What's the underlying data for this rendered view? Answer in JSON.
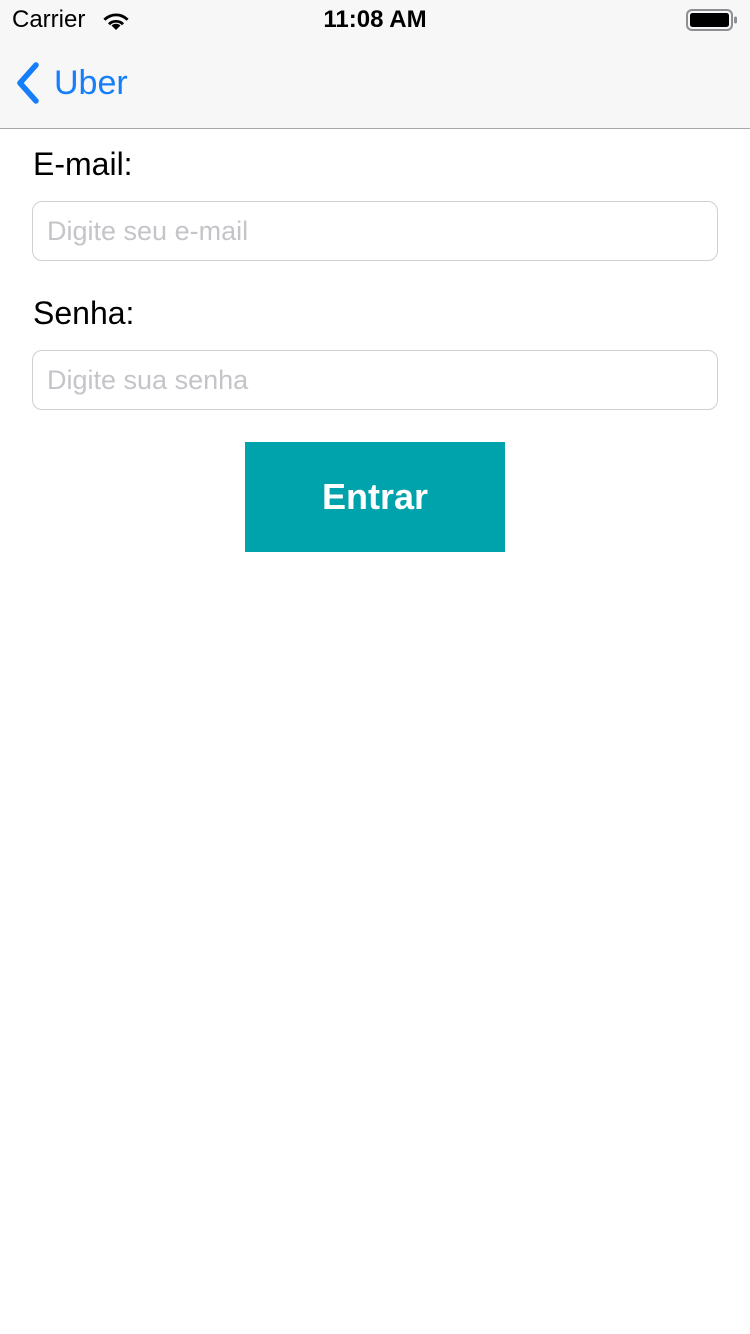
{
  "status_bar": {
    "carrier": "Carrier",
    "time": "11:08 AM",
    "wifi_icon": "wifi-icon",
    "battery_icon": "battery-full-icon"
  },
  "nav_bar": {
    "back_label": "Uber",
    "back_icon": "chevron-left-icon",
    "tint_color": "#147efb"
  },
  "form": {
    "email": {
      "label": "E-mail:",
      "placeholder": "Digite seu e-mail",
      "value": ""
    },
    "password": {
      "label": "Senha:",
      "placeholder": "Digite sua senha",
      "value": ""
    },
    "submit": {
      "label": "Entrar",
      "color": "#00a3ab"
    }
  }
}
